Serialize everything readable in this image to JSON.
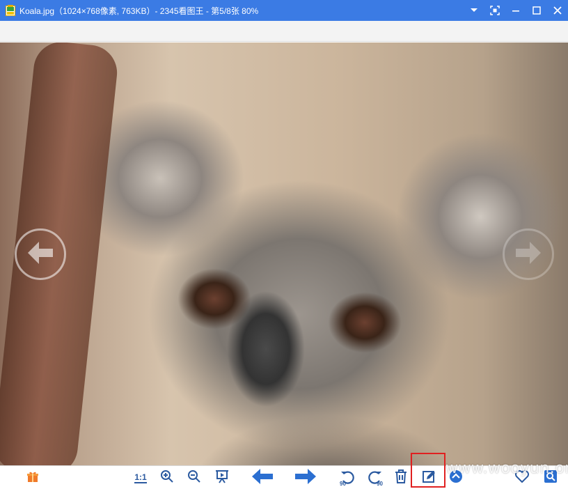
{
  "window": {
    "title": "Koala.jpg（1024×768像素, 763KB）- 2345看图王 - 第5/8张 80%"
  },
  "icons": {
    "app": "app-icon",
    "dropdown": "chevron-down-icon",
    "fullscreen": "fullscreen-icon",
    "minimize": "minimize-icon",
    "maximize": "maximize-icon",
    "close": "close-icon",
    "prev": "arrow-left-icon",
    "next": "arrow-right-icon",
    "gift": "gift-icon",
    "zoom_in": "zoom-in-icon",
    "zoom_out": "zoom-out-icon",
    "slideshow": "slideshow-icon",
    "rotate_left": "rotate-left-icon",
    "rotate_right": "rotate-right-icon",
    "delete": "trash-icon",
    "edit": "edit-icon",
    "more": "chevron-up-icon",
    "favorite": "heart-icon",
    "search": "search-icon"
  },
  "toolbar": {
    "actual_size_label": "1:1",
    "rotate_left_label": "90",
    "rotate_right_label": "90"
  },
  "colors": {
    "titlebar": "#3b7be4",
    "toolbar_icon": "#2b6fd1",
    "highlight": "#e02020"
  },
  "watermark": "www.wooyun.org"
}
